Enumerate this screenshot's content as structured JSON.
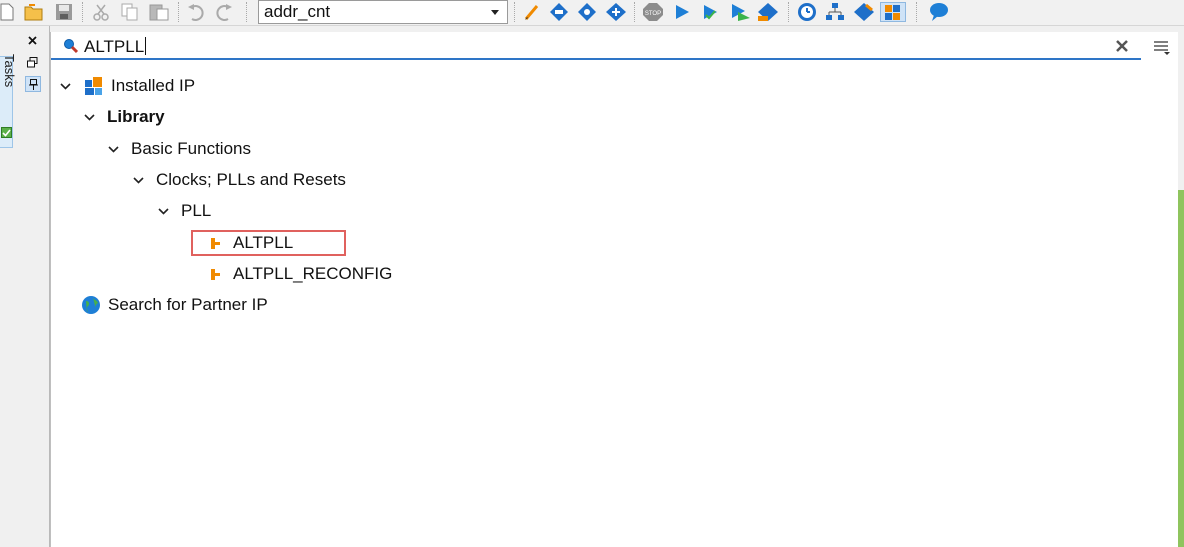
{
  "toolbar": {
    "project_combo_value": "addr_cnt",
    "icons": [
      "new-file-icon",
      "open-folder-icon",
      "save-icon",
      "cut-icon",
      "copy-icon",
      "paste-icon",
      "undo-icon",
      "redo-icon",
      "edit-pencil-icon",
      "analysis-icon",
      "synthesis-icon",
      "fitter-icon",
      "stop-icon",
      "start-compilation-icon",
      "start-analysis-icon",
      "timing-icon",
      "assembler-icon",
      "timing-analyzer-icon",
      "netlist-icon",
      "programmer-icon",
      "ip-catalog-icon",
      "chat-help-icon"
    ]
  },
  "side_panel": {
    "tasks_tab_label": "Tasks"
  },
  "search": {
    "value": "ALTPLL",
    "icons": [
      "search-icon",
      "clear-icon",
      "menu-icon"
    ]
  },
  "tree": {
    "installed_ip": "Installed IP",
    "library": "Library",
    "basic_functions": "Basic Functions",
    "clocks": "Clocks; PLLs and Resets",
    "pll": "PLL",
    "altpll": "ALTPLL",
    "altpll_reconfig": "ALTPLL_RECONFIG",
    "partner_ip": "Search for Partner IP"
  },
  "colors": {
    "search_underline": "#2e75c7",
    "highlight_border": "#e0615e",
    "ip_icon_orange": "#f08a00",
    "globe_blue": "#1e7fd6"
  }
}
